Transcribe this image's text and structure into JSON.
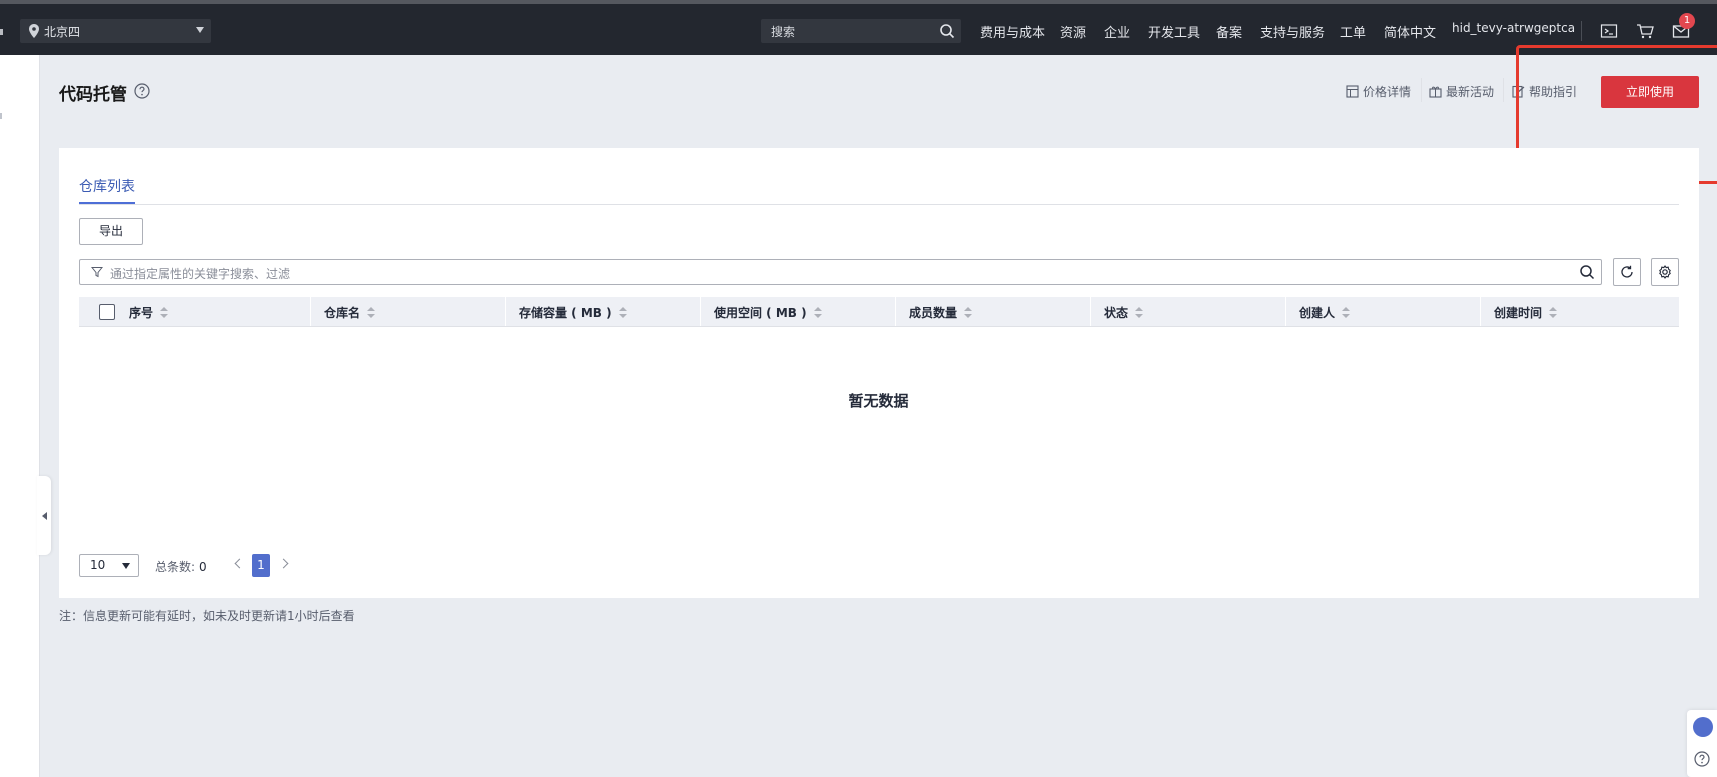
{
  "topbar": {
    "region": "北京四",
    "search_placeholder": "搜索",
    "nav": [
      "费用与成本",
      "资源",
      "企业",
      "开发工具",
      "备案",
      "支持与服务",
      "工单",
      "简体中文"
    ],
    "username": "hid_tevy-atrwgeptca",
    "message_count": "1",
    "icons": [
      "terminal-icon",
      "cart-icon",
      "mail-icon"
    ]
  },
  "page": {
    "title": "代码托管",
    "links": [
      "价格详情",
      "最新活动",
      "帮助指引"
    ],
    "primary_button": "立即使用"
  },
  "tabs": {
    "active": "仓库列表"
  },
  "toolbar": {
    "export": "导出",
    "filter_placeholder": "通过指定属性的关键字搜索、过滤"
  },
  "table": {
    "columns": [
      "序号",
      "仓库名",
      "存储容量 ( MB )",
      "使用空间 ( MB )",
      "成员数量",
      "状态",
      "创建人",
      "创建时间"
    ],
    "empty_text": "暂无数据"
  },
  "pagination": {
    "page_size": "10",
    "total_label": "总条数:",
    "total": "0",
    "current_page": "1"
  },
  "footer_note": "注：信息更新可能有延时，如未及时更新请1小时后查看",
  "colors": {
    "topbar": "#23272f",
    "primary": "#d9363e",
    "accent": "#526ecc",
    "highlight_outline": "#e53a2e"
  }
}
